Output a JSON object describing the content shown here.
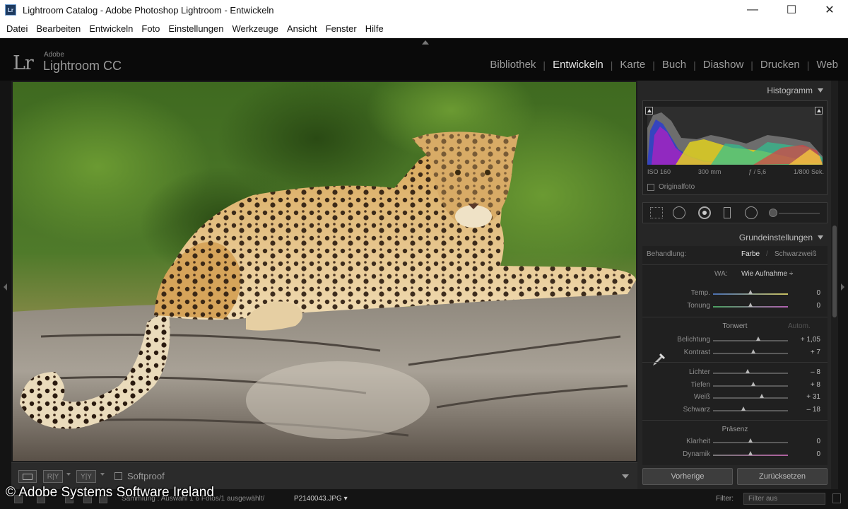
{
  "window": {
    "icon_text": "Lr",
    "title": "Lightroom Catalog - Adobe Photoshop Lightroom - Entwickeln",
    "controls": {
      "minimize": "—",
      "maximize": "☐",
      "close": "✕"
    }
  },
  "menubar": [
    "Datei",
    "Bearbeiten",
    "Entwickeln",
    "Foto",
    "Einstellungen",
    "Werkzeuge",
    "Ansicht",
    "Fenster",
    "Hilfe"
  ],
  "lr_header": {
    "logo_mark": "Lr",
    "brand_small": "Adobe",
    "brand": "Lightroom CC",
    "modules": [
      {
        "label": "Bibliothek",
        "active": false
      },
      {
        "label": "Entwickeln",
        "active": true
      },
      {
        "label": "Karte",
        "active": false
      },
      {
        "label": "Buch",
        "active": false
      },
      {
        "label": "Diashow",
        "active": false
      },
      {
        "label": "Drucken",
        "active": false
      },
      {
        "label": "Web",
        "active": false
      }
    ]
  },
  "toolbar": {
    "view_ry": "R|Y",
    "view_yy": "Y|Y",
    "softproof": "Softproof"
  },
  "histogram": {
    "title": "Histogramm",
    "iso": "ISO 160",
    "focal": "300 mm",
    "aperture": "ƒ / 5,6",
    "shutter": "1/800 Sek.",
    "original_label": "Originalfoto"
  },
  "grund": {
    "title": "Grundeinstellungen",
    "treatment_label": "Behandlung:",
    "treatment_color": "Farbe",
    "treatment_bw": "Schwarzweiß",
    "wb_label": "WA:",
    "wb_value": "Wie Aufnahme ÷",
    "tonwert_title": "Tonwert",
    "auto_label": "Autom.",
    "praesenz_title": "Präsenz",
    "sliders": [
      {
        "label": "Temp.",
        "value": "0",
        "pos": 0.5
      },
      {
        "label": "Tonung",
        "value": "0",
        "pos": 0.5
      },
      {
        "label": "Belichtung",
        "value": "+ 1,05",
        "pos": 0.6
      },
      {
        "label": "Kontrast",
        "value": "+ 7",
        "pos": 0.54
      },
      {
        "label": "Lichter",
        "value": "– 8",
        "pos": 0.46
      },
      {
        "label": "Tiefen",
        "value": "+ 8",
        "pos": 0.54
      },
      {
        "label": "Weiß",
        "value": "+ 31",
        "pos": 0.65
      },
      {
        "label": "Schwarz",
        "value": "– 18",
        "pos": 0.41
      },
      {
        "label": "Klarheit",
        "value": "0",
        "pos": 0.5
      },
      {
        "label": "Dynamik",
        "value": "0",
        "pos": 0.5
      }
    ]
  },
  "buttons": {
    "previous": "Vorherige",
    "reset": "Zurücksetzen"
  },
  "filmstrip": {
    "path": "Sammlung : Auswahl 1    6 Fotos/1 ausgewählt/",
    "file": "P2140043.JPG ▾",
    "filter_label": "Filter:",
    "filter_value": "Filter aus"
  },
  "copyright": "© Adobe Systems Software Ireland",
  "colors": {
    "accent_bg": "#262626",
    "titlebar": "#ffffff",
    "lr_top": "#0a0a0a"
  }
}
